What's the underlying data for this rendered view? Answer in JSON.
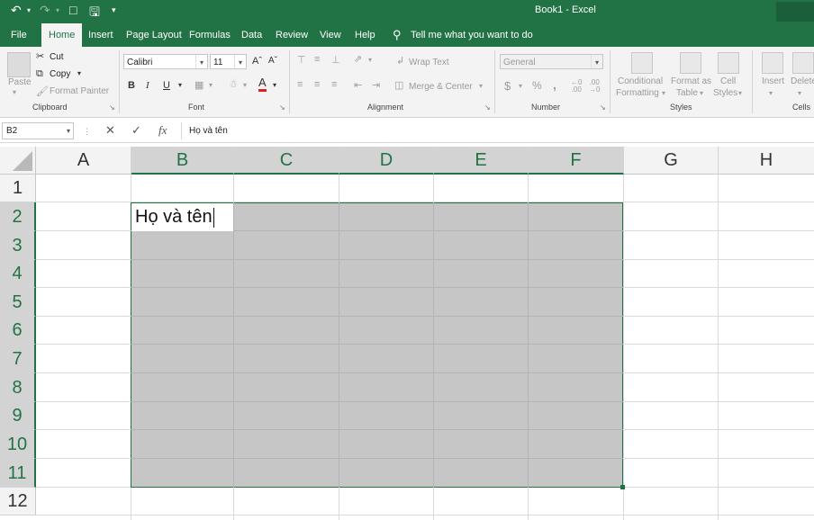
{
  "title_bar": {
    "title": "Book1  -  Excel"
  },
  "tabs": [
    "File",
    "Home",
    "Insert",
    "Page Layout",
    "Formulas",
    "Data",
    "Review",
    "View",
    "Help"
  ],
  "active_tab": "Home",
  "tell_me": "Tell me what you want to do",
  "ribbon": {
    "clipboard": {
      "paste": "Paste",
      "cut": "Cut",
      "copy": "Copy",
      "format_painter": "Format Painter",
      "label": "Clipboard"
    },
    "font": {
      "name": "Calibri",
      "size": "11",
      "label": "Font",
      "bold": "B",
      "italic": "I",
      "underline": "U",
      "grow": "Aˆ",
      "shrink": "Aˇ",
      "font_color": "A"
    },
    "alignment": {
      "wrap_text": "Wrap Text",
      "merge_center": "Merge & Center",
      "label": "Alignment"
    },
    "number": {
      "format": "General",
      "currency": "$",
      "percent": "%",
      "comma": ",",
      "label": "Number"
    },
    "styles": {
      "conditional_1": "Conditional",
      "conditional_2": "Formatting",
      "format_as_1": "Format as",
      "format_as_2": "Table",
      "cell_styles_1": "Cell",
      "cell_styles_2": "Styles",
      "label": "Styles"
    },
    "cells": {
      "insert": "Insert",
      "delete": "Delete",
      "label": "Cells"
    }
  },
  "formula_bar": {
    "name_box": "B2",
    "cancel": "✕",
    "enter": "✓",
    "fx": "fx",
    "content": "Họ và tên"
  },
  "columns": [
    "A",
    "B",
    "C",
    "D",
    "E",
    "F",
    "G",
    "H"
  ],
  "rows": [
    "1",
    "2",
    "3",
    "4",
    "5",
    "6",
    "7",
    "8",
    "9",
    "10",
    "11",
    "12"
  ],
  "cells": {
    "B2": "Họ và tên"
  },
  "colors": {
    "accent": "#217346",
    "selection_fill": "#c6c6c6"
  }
}
